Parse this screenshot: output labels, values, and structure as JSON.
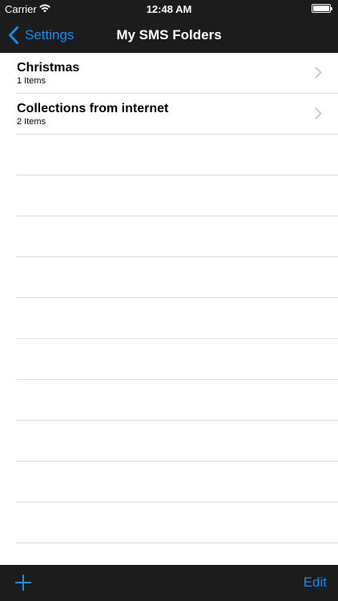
{
  "status_bar": {
    "carrier": "Carrier",
    "time": "12:48 AM"
  },
  "nav_bar": {
    "back_label": "Settings",
    "title": "My SMS Folders"
  },
  "folders": [
    {
      "name": "Christmas",
      "count": "1 Items"
    },
    {
      "name": "Collections from internet",
      "count": "2 Items"
    }
  ],
  "toolbar": {
    "add_icon": "plus-icon",
    "edit_label": "Edit"
  },
  "colors": {
    "accent": "#1e8bf0",
    "bar_background": "#1c1c1c",
    "separator": "#dcdcdc"
  }
}
